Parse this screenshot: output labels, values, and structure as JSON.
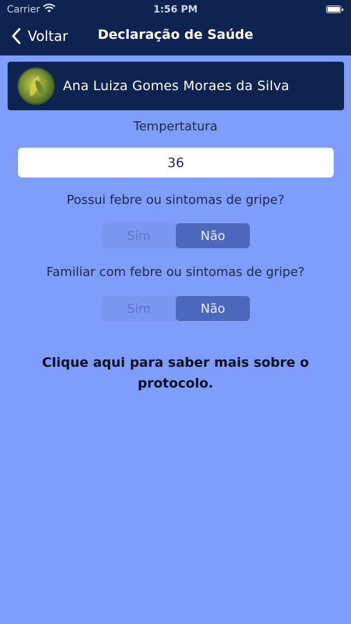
{
  "status_bar": {
    "carrier": "Carrier",
    "time": "1:56 PM",
    "wifi_icon": "wifi-icon",
    "battery_icon": "battery-icon"
  },
  "nav": {
    "back_label": "Voltar",
    "title": "Declaração de Saúde",
    "back_icon": "chevron-left-icon"
  },
  "profile": {
    "name": "Ana Luiza Gomes Moraes da Silva"
  },
  "form": {
    "temperature_label": "Tempertatura",
    "temperature_value": "36",
    "question1": "Possui febre ou sintomas de gripe?",
    "question1_options": [
      "Sim",
      "Não"
    ],
    "question1_selected": "Não",
    "question2": "Familiar com febre ou sintomas de gripe?",
    "question2_options": [
      "Sim",
      "Não"
    ],
    "question2_selected": "Não"
  },
  "protocol_link": "Clique aqui para saber mais sobre o protocolo.",
  "colors": {
    "background": "#7f9dfb",
    "navbar": "#0e2350",
    "segment_active": "#4c68bd"
  }
}
